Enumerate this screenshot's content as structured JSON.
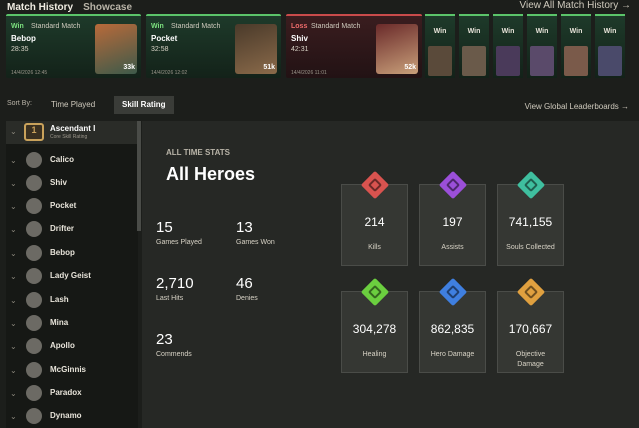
{
  "header": {
    "tab1": "Match History",
    "tab2": "Showcase",
    "view_all": "View All Match History →"
  },
  "matches": [
    {
      "result": "Win",
      "type": "Standard Match",
      "hero": "Bebop",
      "time": "28:35",
      "date": "14/4/2026 12:45",
      "souls": "33k"
    },
    {
      "result": "Win",
      "type": "Standard Match",
      "hero": "Pocket",
      "time": "32:58",
      "date": "14/4/2026 12:02",
      "souls": "51k"
    },
    {
      "result": "Loss",
      "type": "Standard Match",
      "hero": "Shiv",
      "time": "42:31",
      "date": "14/4/2026 11:01",
      "souls": "52k"
    }
  ],
  "small_matches": [
    "Win",
    "Win",
    "Win",
    "Win",
    "Win",
    "Win",
    "Win"
  ],
  "sort": {
    "label": "Sort By:",
    "opt1": "Time Played",
    "opt2": "Skill Rating",
    "global": "View Global Leaderboards →"
  },
  "rank": {
    "num": "1",
    "name": "Ascendant I",
    "sub": "Core Skill Rating"
  },
  "heroes": [
    "Calico",
    "Shiv",
    "Pocket",
    "Drifter",
    "Bebop",
    "Lady Geist",
    "Lash",
    "Mina",
    "Apollo",
    "McGinnis",
    "Paradox",
    "Dynamo"
  ],
  "stats": {
    "title_small": "ALL TIME STATS",
    "title": "All Heroes",
    "games_played": "15",
    "games_played_label": "Games Played",
    "games_won": "13",
    "games_won_label": "Games Won",
    "last_hits": "2,710",
    "last_hits_label": "Last Hits",
    "denies": "46",
    "denies_label": "Denies",
    "commends": "23",
    "commends_label": "Commends"
  },
  "boxes": [
    {
      "value": "214",
      "label": "Kills",
      "color": "#d9534f"
    },
    {
      "value": "197",
      "label": "Assists",
      "color": "#9b4fd9"
    },
    {
      "value": "741,155",
      "label": "Souls Collected",
      "color": "#3fbf9f"
    },
    {
      "value": "304,278",
      "label": "Healing",
      "color": "#6bcf3f"
    },
    {
      "value": "862,835",
      "label": "Hero Damage",
      "color": "#3f7fe0"
    },
    {
      "value": "170,667",
      "label": "Objective Damage",
      "color": "#e0a03f"
    }
  ]
}
